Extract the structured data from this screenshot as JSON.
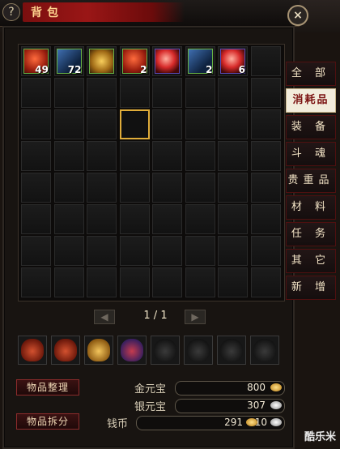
{
  "window": {
    "title": "背包",
    "help": "?",
    "close": "×"
  },
  "inventory": {
    "items": [
      {
        "slot": 0,
        "icon": "sword-scroll-icon",
        "style": "ic-red",
        "qty": "49"
      },
      {
        "slot": 1,
        "icon": "blue-blade-icon",
        "style": "ic-blue",
        "qty": "72"
      },
      {
        "slot": 2,
        "icon": "treasure-chest-icon",
        "style": "ic-gold",
        "qty": ""
      },
      {
        "slot": 3,
        "icon": "fire-bundle-icon",
        "style": "ic-red",
        "qty": "2"
      },
      {
        "slot": 4,
        "icon": "red-orb-icon",
        "style": "ic-orb",
        "qty": ""
      },
      {
        "slot": 5,
        "icon": "crystal-blade-icon",
        "style": "ic-blue",
        "qty": "2"
      },
      {
        "slot": 6,
        "icon": "fire-orb-icon",
        "style": "ic-orb",
        "qty": "6"
      }
    ],
    "highlighted_slot": 19
  },
  "pager": {
    "text": "1 / 1",
    "prev": "◀",
    "next": "▶"
  },
  "bags": [
    "bag-red",
    "bag-red",
    "bag-yellow",
    "bag-purple",
    "bag-empty",
    "bag-empty",
    "bag-empty",
    "bag-empty"
  ],
  "buttons": {
    "sort": "物品整理",
    "split": "物品拆分"
  },
  "currency": {
    "gold_label": "金元宝",
    "gold_value": "800",
    "silver_label": "银元宝",
    "silver_value": "307",
    "coin_label": "钱币",
    "coin_value": "291",
    "coin_value2": "10"
  },
  "tabs": [
    "全 部",
    "消耗品",
    "装 备",
    "斗 魂",
    "贵重品",
    "材 料",
    "任 务",
    "其 它",
    "新 增"
  ],
  "active_tab": 1,
  "watermark": "酷乐米"
}
